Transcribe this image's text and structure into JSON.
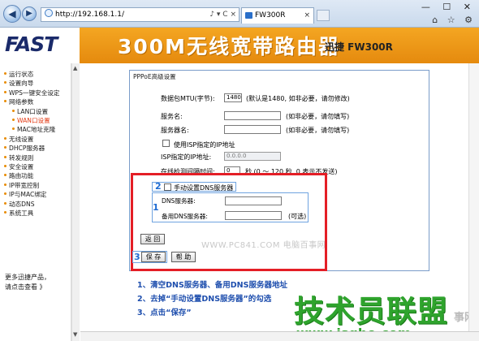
{
  "browser": {
    "url": "http://192.168.1.1/",
    "tab_title": "FW300R",
    "tools": "♪ ▾ C ×",
    "window_buttons": "— ☐ ✕",
    "sys_icons": "⌂ ☆ ⚙",
    "tab_close": "×"
  },
  "banner": {
    "logo": "FAST",
    "title": "300M无线宽带路由器",
    "model": "迅捷 FW300R"
  },
  "sidebar": {
    "items": [
      {
        "label": "运行状态",
        "level": 0
      },
      {
        "label": "设置向导",
        "level": 0
      },
      {
        "label": "WPS一键安全设定",
        "level": 0
      },
      {
        "label": "网络参数",
        "level": 0
      },
      {
        "label": "LAN口设置",
        "level": 1
      },
      {
        "label": "WAN口设置",
        "level": 1,
        "active": true
      },
      {
        "label": "MAC地址克隆",
        "level": 1
      },
      {
        "label": "无线设置",
        "level": 0
      },
      {
        "label": "DHCP服务器",
        "level": 0
      },
      {
        "label": "转发规则",
        "level": 0
      },
      {
        "label": "安全设置",
        "level": 0
      },
      {
        "label": "路由功能",
        "level": 0
      },
      {
        "label": "IP带宽控制",
        "level": 0
      },
      {
        "label": "IP与MAC绑定",
        "level": 0
      },
      {
        "label": "动态DNS",
        "level": 0
      },
      {
        "label": "系统工具",
        "level": 0
      }
    ],
    "more_line1": "更多迅捷产品，",
    "more_line2": "请点击查看 》"
  },
  "form": {
    "panel_title": "PPPoE高级设置",
    "mtu_label": "数据包MTU(字节):",
    "mtu_value": "1480",
    "mtu_hint": "(默认是1480, 如非必要，请勿修改)",
    "service_name_label": "服务名:",
    "service_name_value": "",
    "service_name_hint": "(如非必要，请勿填写)",
    "server_name_label": "服务器名:",
    "server_name_value": "",
    "server_name_hint": "(如非必要，请勿填写)",
    "use_isp_ip_label": "使用ISP指定的IP地址",
    "isp_ip_label": "ISP指定的IP地址:",
    "isp_ip_value": "0.0.0.0",
    "detect_label": "在线检测间隔时间:",
    "detect_value": "0",
    "detect_hint": "秒 (0 ～ 120 秒, 0 表示不发送)",
    "manual_dns_label": "手动设置DNS服务器",
    "dns_label": "DNS服务器:",
    "dns_value": "",
    "alt_dns_label": "备用DNS服务器:",
    "alt_dns_value": "",
    "alt_dns_hint": "(可选)",
    "back_button": "返 回",
    "save_button": "保 存",
    "help_button": "帮 助",
    "badge_1": "1",
    "badge_2": "2",
    "badge_3": "3"
  },
  "watermarks": {
    "site_text": "WWW.PC841.COM 电脑百事网",
    "big_text": "技术员联盟",
    "url_text": "www.jsgho.com",
    "corner_text": "事网"
  },
  "steps": [
    "1、清空DNS服务器、备用DNS服务器地址",
    "2、去掉“手动设置DNS服务器”的勾选",
    "3、点击“保存”"
  ],
  "colors": {
    "banner": "#f0a020",
    "highlight_red": "#e41e26",
    "step_blue": "#1f4fae",
    "watermark_green": "#2fa42d"
  }
}
